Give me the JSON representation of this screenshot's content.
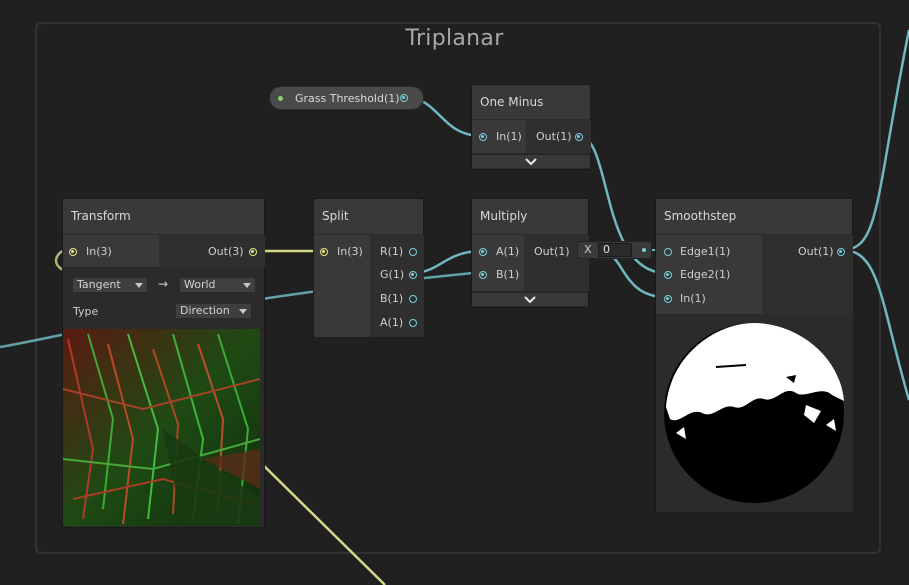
{
  "group": {
    "title": "Triplanar"
  },
  "property_node": {
    "label": "Grass Threshold(1)"
  },
  "nodes": {
    "transform": {
      "title": "Transform",
      "in_label": "In(3)",
      "out_label": "Out(3)",
      "from_space": "Tangent",
      "to_space": "World",
      "arrow": "→",
      "type_label": "Type",
      "type_value": "Direction"
    },
    "split": {
      "title": "Split",
      "in_label": "In(3)",
      "outputs": [
        "R(1)",
        "G(1)",
        "B(1)",
        "A(1)"
      ]
    },
    "one_minus": {
      "title": "One Minus",
      "in_label": "In(1)",
      "out_label": "Out(1)"
    },
    "multiply": {
      "title": "Multiply",
      "inputs": [
        "A(1)",
        "B(1)"
      ],
      "out_label": "Out(1)",
      "b_default_axis": "X",
      "b_default_value": "0"
    },
    "smoothstep": {
      "title": "Smoothstep",
      "inputs": [
        "Edge1(1)",
        "Edge2(1)",
        "In(1)"
      ],
      "out_label": "Out(1)"
    }
  },
  "colors": {
    "wire_float": "#6fb8c0",
    "wire_vector3": "#d7d78a",
    "port_float": "#7ad0d8",
    "port_vector3": "#e7e786",
    "property_dot": "#8fd16a"
  },
  "icons": {
    "expand": "chevron-down-icon",
    "dropdown": "triangle-down-icon",
    "arrow": "arrow-right-icon"
  }
}
